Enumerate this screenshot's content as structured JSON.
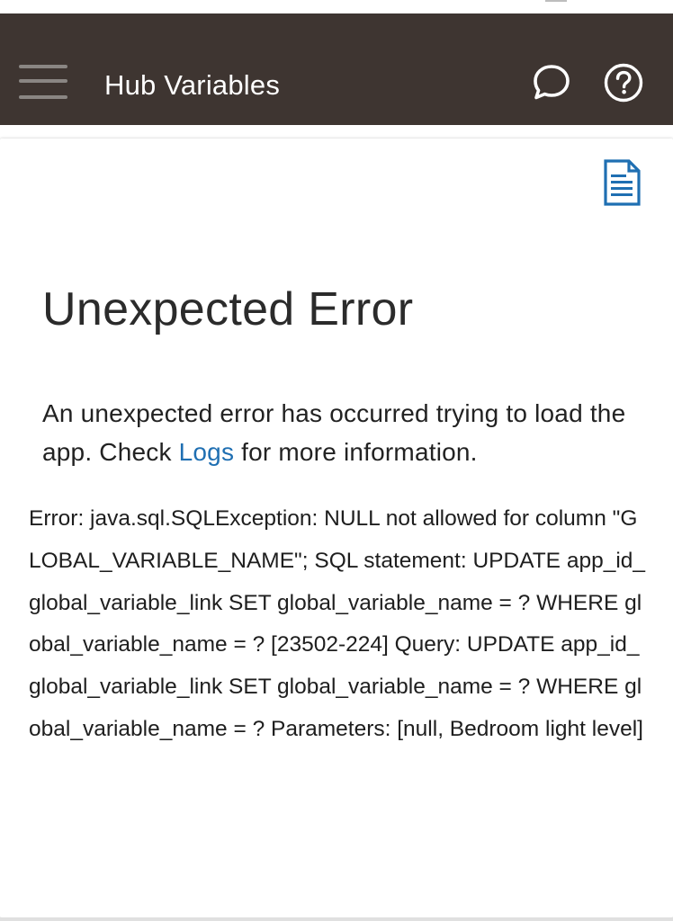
{
  "appbar": {
    "title": "Hub Variables",
    "menu_icon": "hamburger-menu-icon",
    "chat_icon": "chat-bubble-icon",
    "help_icon": "question-circle-icon",
    "background": "#3e3531"
  },
  "card": {
    "doc_icon": "document-icon",
    "heading": "Unexpected Error",
    "message_before": "An unexpected error has occurred trying to load the app. Check ",
    "logs_link": "Logs",
    "message_after": " for more information.",
    "error_text": "Error: java.sql.SQLException: NULL not allowed for column \"GLOBAL_VARIABLE_NAME\"; SQL statement: UPDATE app_id_global_variable_link SET global_variable_name = ? WHERE global_variable_name = ? [23502-224] Query: UPDATE app_id_global_variable_link SET global_variable_name = ? WHERE global_variable_name = ? Parameters: [null, Bedroom light level]",
    "link_color": "#1f6fb2"
  }
}
